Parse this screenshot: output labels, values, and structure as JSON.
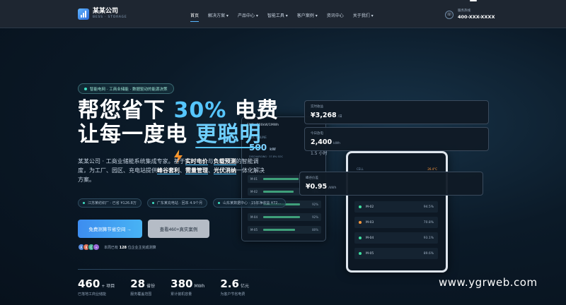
{
  "nav": {
    "logo_name": "某某公司",
    "logo_sub": "BESS · STORAGE",
    "menu": [
      "首页",
      "解决方案 ▾",
      "产品中心 ▾",
      "智能工具 ▾",
      "客户案例 ▾",
      "资讯中心",
      "关于我们 ▾"
    ],
    "phone_label": "服务热线",
    "phone_number": "400-XXX-XXXX"
  },
  "hero": {
    "tag": "智能电网 · 工商业储能 · 数据驱动的能源决策",
    "title_l1_a": "帮您省下 ",
    "title_l1_b": "30%",
    "title_l1_c": " 电费",
    "title_l2_a": "让每一度电 ",
    "title_l2_b": "更聪明",
    "desc_a": "某某公司 · 工商业储能系统集成专家。基于",
    "desc_b": "实时电价",
    "desc_c": "与",
    "desc_d": "负载预测",
    "desc_e": "的智能调度，为工厂、园区、充电站提供",
    "desc_f": "峰谷套利",
    "desc_g": "、",
    "desc_h": "需量管理",
    "desc_i": "、",
    "desc_j": "光伏消纳",
    "desc_k": "一体化解决方案。",
    "chips": [
      "江苏某纺织厂 · 已省 ¥126.8万",
      "广东某充电站 · 回本 4.9个月",
      "山东某数据中心 · 15年净收益 ¥72..."
    ],
    "btn_primary": "免费测算节省空间 →",
    "btn_secondary": "查看460+真实案例",
    "avatars": [
      "A",
      "B",
      "C",
      "+"
    ],
    "users_a": "本周已有 ",
    "users_count": "128",
    "users_b": " 位企业主完成测算"
  },
  "stats": [
    {
      "value": "460",
      "unit": "+ 项目",
      "label": "已落地工商业储能"
    },
    {
      "value": "28",
      "unit": "省份",
      "label": "服务覆盖范围"
    },
    {
      "value": "380",
      "unit": "MWh",
      "label": "累计装机容量"
    },
    {
      "value": "2.6",
      "unit": "亿元",
      "label": "为客户节省电费"
    }
  ],
  "tablet": {
    "top": "EMS · 500kW/1MWh",
    "label": "SOC ONLINE",
    "big": "500",
    "big_unit": "kW",
    "sub": "DISCHARGING · 37.8% SOC",
    "rows": [
      {
        "name": "M-01",
        "pct": "89%",
        "fill": 0.89
      },
      {
        "name": "M-02",
        "pct": "76%",
        "fill": 0.76
      },
      {
        "name": "M-03",
        "pct": "92%",
        "fill": 0.92
      },
      {
        "name": "M-04",
        "pct": "92%",
        "fill": 0.92
      },
      {
        "name": "M-05",
        "pct": "80%",
        "fill": 0.8
      }
    ]
  },
  "phone_device": {
    "temp_label": "CELL",
    "temp": "26.4°C",
    "rows": [
      {
        "name": "M-02",
        "val": "94.5%",
        "color": "#3fe0a0"
      },
      {
        "name": "M-03",
        "val": "70.8%",
        "color": "#ff9a3c"
      },
      {
        "name": "M-04",
        "val": "93.1%",
        "color": "#3fe0a0"
      },
      {
        "name": "M-05",
        "val": "89.6%",
        "color": "#3fe0a0"
      }
    ]
  },
  "cards": {
    "c1_label": "实时收益",
    "c1_val": "¥3,268",
    "c1_unit": "/日",
    "c2_label": "今日放电",
    "c2_val": "2,400",
    "c2_unit": "kWh",
    "c2_extra": "1.5 小时",
    "c3_label": "峰谷价差",
    "c3_val": "¥0.95",
    "c3_unit": "/kWh"
  },
  "watermark": "www.ygrweb.com"
}
